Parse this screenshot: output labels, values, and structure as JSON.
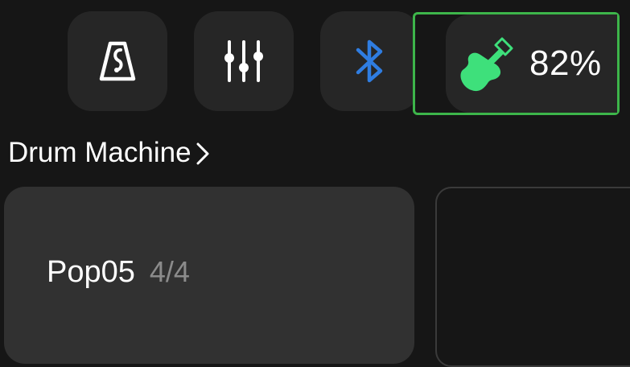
{
  "toolbar": {
    "metronome_icon": "metronome-icon",
    "mixer_icon": "mixer-sliders-icon",
    "bluetooth_icon": "bluetooth-icon",
    "bluetooth_color": "#2f7de1"
  },
  "battery": {
    "icon": "guitar-icon",
    "icon_color": "#3ee07b",
    "highlight_color": "#3db54a",
    "level_text": "82%"
  },
  "drum_machine": {
    "title": "Drum Machine",
    "pattern_name": "Pop05",
    "time_signature": "4/4"
  }
}
